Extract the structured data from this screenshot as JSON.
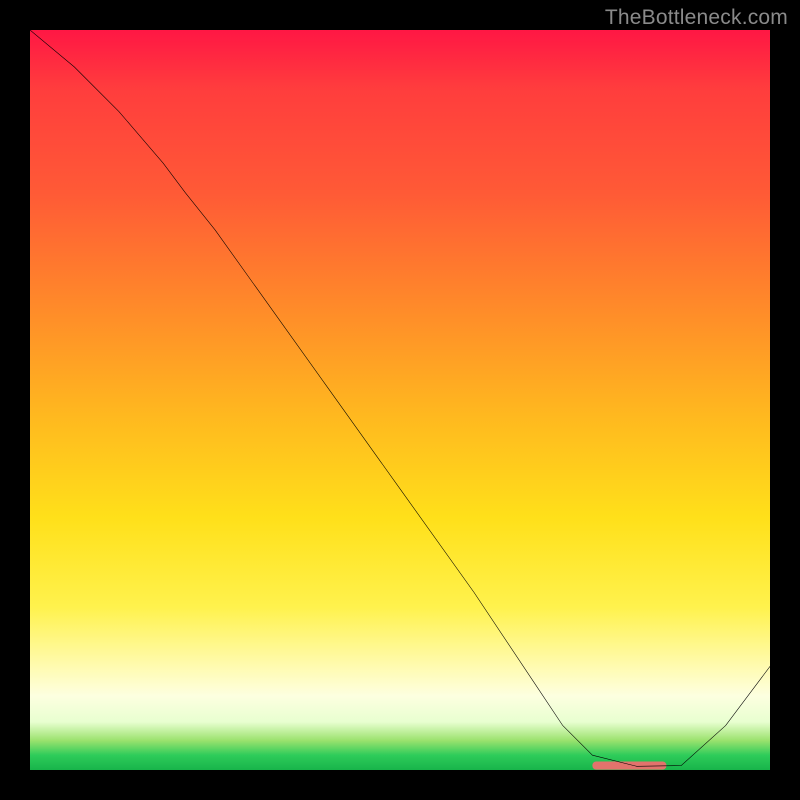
{
  "watermark": "TheBottleneck.com",
  "chart_data": {
    "type": "line",
    "title": "",
    "xlabel": "",
    "ylabel": "",
    "xlim": [
      0,
      100
    ],
    "ylim": [
      0,
      100
    ],
    "series": [
      {
        "name": "curve",
        "x": [
          0,
          6,
          12,
          18,
          21,
          25,
          30,
          40,
          50,
          60,
          68,
          72,
          76,
          82,
          88,
          94,
          100
        ],
        "y": [
          100,
          95,
          89,
          82,
          78,
          73,
          66,
          52,
          38,
          24,
          12,
          6,
          2,
          0.5,
          0.6,
          6,
          14
        ]
      }
    ],
    "markers": [
      {
        "name": "optimal-band",
        "x_start": 76,
        "x_end": 86,
        "y": 0.6
      }
    ],
    "gradient_stops": [
      {
        "pct": 0,
        "color": "#ff1744"
      },
      {
        "pct": 22,
        "color": "#ff5a36"
      },
      {
        "pct": 52,
        "color": "#ffb81f"
      },
      {
        "pct": 78,
        "color": "#fff24d"
      },
      {
        "pct": 90,
        "color": "#fdffe0"
      },
      {
        "pct": 96,
        "color": "#9be26e"
      },
      {
        "pct": 100,
        "color": "#18b44a"
      }
    ],
    "marker_color": "#e2736c"
  }
}
